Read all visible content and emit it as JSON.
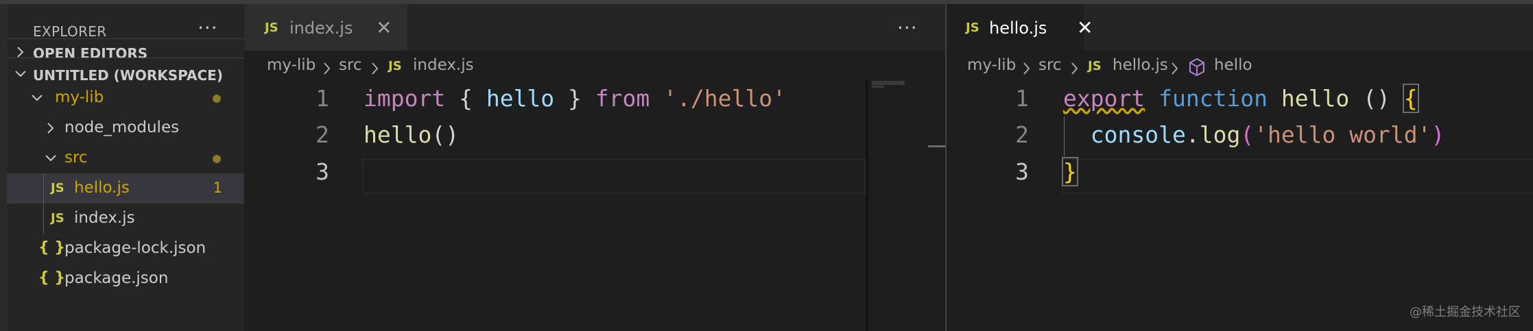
{
  "explorer": {
    "title": "EXPLORER",
    "more": "···",
    "sections": {
      "open_editors": "OPEN EDITORS",
      "workspace": "UNTITLED (WORKSPACE)"
    },
    "tree": {
      "my_lib": "my-lib",
      "node_modules": "node_modules",
      "src": "src",
      "hello_js": "hello.js",
      "hello_js_badge": "1",
      "index_js": "index.js",
      "package_lock": "package-lock.json",
      "package_json": "package.json",
      "js_icon": "JS",
      "json_icon": "{ }"
    }
  },
  "left_editor": {
    "tab_label": "index.js",
    "tab_icon": "JS",
    "close": "✕",
    "more": "···",
    "breadcrumb": [
      "my-lib",
      "src",
      "index.js"
    ],
    "line_numbers": [
      "1",
      "2",
      "3"
    ],
    "code": {
      "l1_import": "import",
      "l1_open": " { ",
      "l1_hello": "hello",
      "l1_close": " } ",
      "l1_from": "from",
      "l1_space": " ",
      "l1_path": "'./hello'",
      "l2_hello": "hello",
      "l2_paren": "()"
    }
  },
  "right_editor": {
    "tab_label": "hello.js",
    "tab_icon": "JS",
    "close": "✕",
    "breadcrumb": [
      "my-lib",
      "src",
      "hello.js",
      "hello"
    ],
    "line_numbers": [
      "1",
      "2",
      "3"
    ],
    "code": {
      "l1_export": "export",
      "l1_function": "function",
      "l1_hello": "hello",
      "l1_parens": "()",
      "l1_brace": "{",
      "l2_console": "console",
      "l2_dot": ".",
      "l2_log": "log",
      "l2_open": "(",
      "l2_str": "'hello world'",
      "l2_close": ")",
      "l3_brace": "}"
    }
  },
  "watermark": "@稀土掘金技术社区"
}
